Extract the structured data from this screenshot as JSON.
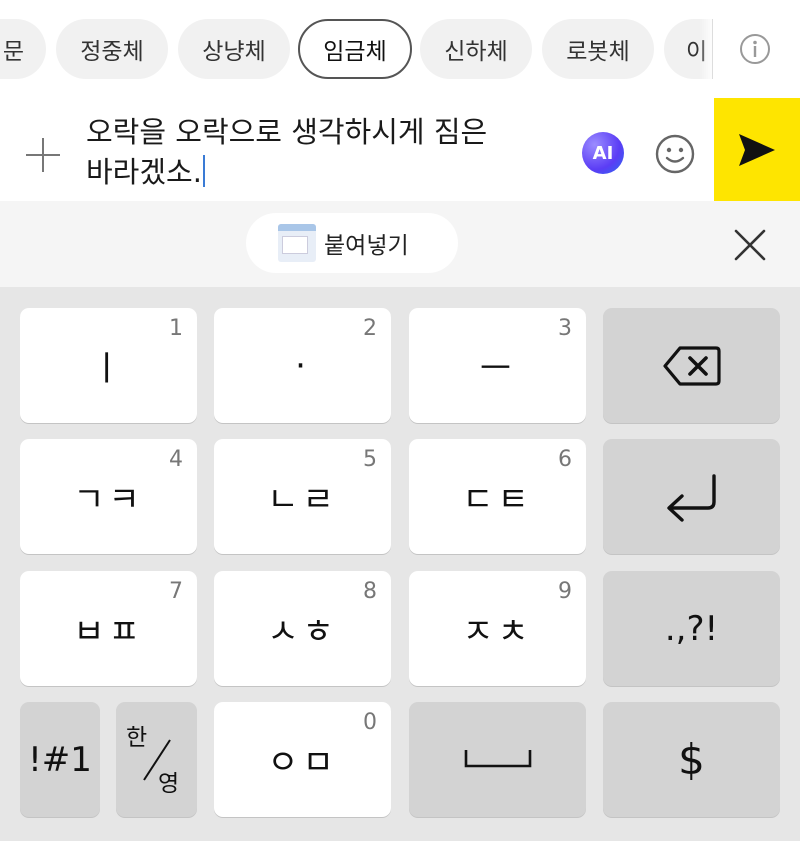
{
  "font_chips": [
    {
      "label": "문",
      "selected": false
    },
    {
      "label": "정중체",
      "selected": false
    },
    {
      "label": "상냥체",
      "selected": false
    },
    {
      "label": "임금체",
      "selected": true
    },
    {
      "label": "신하체",
      "selected": false
    },
    {
      "label": "로봇체",
      "selected": false
    },
    {
      "label": "이",
      "selected": false
    }
  ],
  "composer": {
    "message": "오락을 오락으로 생각하시게 짐은 바라겠소.",
    "ai_label": "AI"
  },
  "clipboard": {
    "paste_label": "붙여넣기"
  },
  "keyboard": {
    "rows": [
      [
        {
          "label": "ㅣ",
          "hint": "1"
        },
        {
          "label": "·",
          "hint": "2"
        },
        {
          "label": "ㅡ",
          "hint": "3"
        },
        {
          "label": "",
          "icon": "backspace-icon"
        }
      ],
      [
        {
          "label": "ㄱㅋ",
          "hint": "4"
        },
        {
          "label": "ㄴㄹ",
          "hint": "5"
        },
        {
          "label": "ㄷㅌ",
          "hint": "6"
        },
        {
          "label": "",
          "icon": "enter-icon"
        }
      ],
      [
        {
          "label": "ㅂㅍ",
          "hint": "7"
        },
        {
          "label": "ㅅㅎ",
          "hint": "8"
        },
        {
          "label": "ㅈㅊ",
          "hint": "9"
        },
        {
          "label": ".,?!"
        }
      ],
      [
        {
          "label": "!#1"
        },
        {
          "label_top": "한",
          "label_bottom": "영"
        },
        {
          "label": "ㅇㅁ",
          "hint": "0"
        },
        {
          "label": "",
          "icon": "space-icon"
        },
        {
          "label": "$"
        }
      ]
    ]
  },
  "colors": {
    "send_button": "#fee500",
    "caret": "#3a7bd5",
    "keyboard_bg": "#e6e6e6",
    "func_key": "#d3d3d3"
  }
}
